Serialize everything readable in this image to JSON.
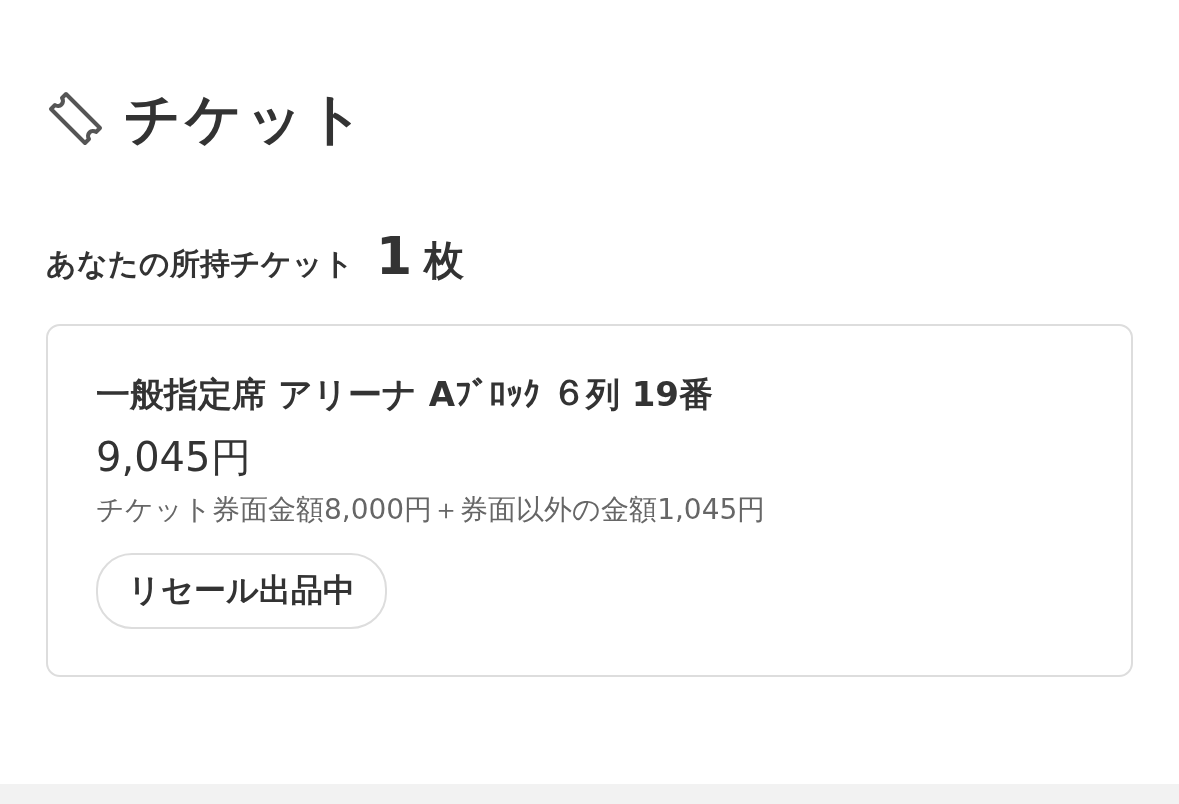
{
  "section": {
    "title": "チケット"
  },
  "owned": {
    "label": "あなたの所持チケット",
    "count": "1",
    "unit": "枚"
  },
  "tickets": [
    {
      "seat": "一般指定席 アリーナ Aﾌﾞﾛｯｸ ６列 19番",
      "price": "9,045円",
      "breakdown": "チケット券面金額8,000円＋券面以外の金額1,045円",
      "status": "リセール出品中"
    }
  ]
}
